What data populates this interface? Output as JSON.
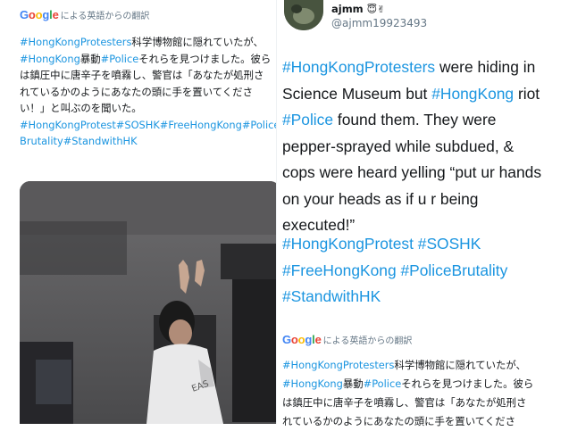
{
  "left": {
    "translate_bar": {
      "logo": [
        "G",
        "o",
        "o",
        "g",
        "l",
        "e"
      ],
      "label": "による英語からの翻訳"
    },
    "jp_lines": [
      {
        "tag": "#HongKongProtesters",
        "text": "科学博物館に隠れていたが、"
      },
      {
        "tag": "#HongKong",
        "mid": "暴動",
        "tag2": "#Police",
        "text": "それらを見つけました。彼ら"
      },
      {
        "text": "は鎮圧中に唐辛子を噴霧し、警官は「あなたが処刑さ"
      },
      {
        "text": "れているかのようにあなたの頭に手を置いてくださ"
      },
      {
        "text": "い！」と叫ぶのを聞いた。"
      },
      {
        "tag": "#HongKongProtest#SOSHK#FreeHongKong#Police"
      },
      {
        "tag": "Brutality#StandwithHK"
      }
    ]
  },
  "right": {
    "user": {
      "name": "ajmm",
      "emoji": "😇✌",
      "handle": "@ajmm19923493"
    },
    "body_lines": [
      {
        "tag": "#HongKongProtesters",
        "text": " were hiding in"
      },
      {
        "text": "Science Museum but ",
        "tag": "#HongKong",
        "text2": " riot"
      },
      {
        "tag": "#Police",
        "text": " found them. They were"
      },
      {
        "text": "pepper-sprayed while subdued, &"
      },
      {
        "text": "cops were heard yelling “put ur hands"
      },
      {
        "text": "on your heads as if u r being"
      },
      {
        "text": "executed!”"
      }
    ],
    "hashtag_lines": [
      "#HongKongProtest #SOSHK",
      "#FreeHongKong #PoliceBrutality",
      "#StandwithHK"
    ],
    "translate_bar": {
      "logo": [
        "G",
        "o",
        "o",
        "g",
        "l",
        "e"
      ],
      "label": "による英語からの翻訳"
    },
    "jp_lines": [
      {
        "tag": "#HongKongProtesters",
        "text": "科学博物館に隠れていたが、"
      },
      {
        "tag": "#HongKong",
        "mid": "暴動",
        "tag2": "#Police",
        "text": "それらを見つけました。彼ら"
      },
      {
        "text": "は鎮圧中に唐辛子を噴霧し、警官は「あなたが処刑さ"
      },
      {
        "text": "れているかのようにあなたの頭に手を置いてくださ"
      }
    ]
  }
}
